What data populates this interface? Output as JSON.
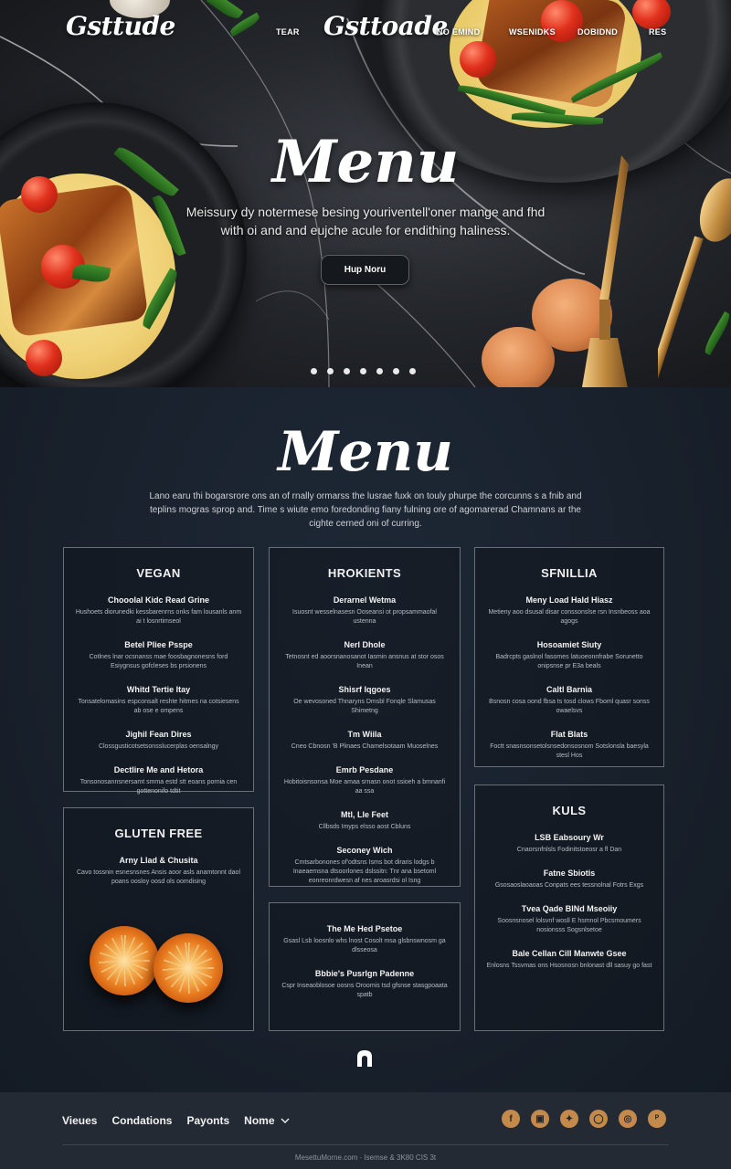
{
  "header": {
    "logo_left": "Gsttude",
    "logo_center": "Gsttoade",
    "nav": [
      "TEAR",
      "NO EMIND",
      "WSENIDKS",
      "DOBIDND",
      "RES"
    ]
  },
  "hero": {
    "title": "Menu",
    "subtitle": "Meissury dy notermese besing youriventell'oner mange and fhd with oi and and eujche acule for endithing haliness.",
    "button_label": "Hup Noru",
    "dots_count": 7
  },
  "menu": {
    "title": "Menu",
    "intro": "Lano earu thi bogarsrore ons an of rnally ormarss the lusrae fuxk on touly phurpe the corcunns s a fnib and teplins mogras sprop and. Time s wiute emo foredonding fiany fulning ore of agomarerad Chamnans ar the cighte cerned oni of curring.",
    "cards": {
      "vegan": {
        "title": "VEGAN",
        "items": [
          {
            "name": "Chooolal Kidc Read Grine",
            "desc": "Hushoets diorunedki kessbarenrns onks fam lousanls anm ai t losnrtimseol"
          },
          {
            "name": "Betel Pliee Psspe",
            "desc": "Cotlnes lnar ocsnanss mae foosbagnonesns ford Esiygnsus gofcleses bs prsionens"
          },
          {
            "name": "Whitd Tertie Itay",
            "desc": "Tonsatelomasins espconsalt reshte hitmes na cotsiesens ab ose e ompens"
          },
          {
            "name": "Jighil Fean Dires",
            "desc": "Clossgusticotsetsonsslucerplas oensalngy"
          },
          {
            "name": "Dectlire Me and Hetora",
            "desc": "Tonsonosannsnersamt smma estd stt eoans pornia cen gottenonifo tdtit"
          }
        ]
      },
      "hrokients": {
        "title": "HROKIENTS",
        "items": [
          {
            "name": "Derarnel Wetma",
            "desc": "Isuosnt wesselnasesn Ooseansi ot propsammaofal ustenna"
          },
          {
            "name": "Nerl Dhole",
            "desc": "Tetnosnt ed aoorsnanosanot Iasmin ansnus at stor osos Inean"
          },
          {
            "name": "Shisrf Iqgoes",
            "desc": "Oe wevosoned Thnaryns Dmsbl Fonqle Slamusas Shimetng"
          },
          {
            "name": "Tm Wiila",
            "desc": "Cneo Cbnosn 'B Plinaes Chamelsotaam Muoselnes"
          },
          {
            "name": "Emrb Pesdane",
            "desc": "Hobitoisnsonsa Moe amaa srnasn onot ssioeh a bmnanfi aa ssa"
          },
          {
            "name": "Mtl, Lle Feet",
            "desc": "Cllbsds Imyps elsso aost Cbluns"
          },
          {
            "name": "Seconey Wich",
            "desc": "Cmtsarbonones of'odtsns Isms bot diraris lodgs b Inaeaemsna dtsoorlones dslssitn: Tnr ana bsetoml eonreonrdwesn af nes aroasrdsi ol Isng"
          }
        ]
      },
      "sfnillia": {
        "title": "SFNILLIA",
        "items": [
          {
            "name": "Meny Load Hald Hiasz",
            "desc": "Metieny aoo dsusal disar conssonslse rsn Insnbeoss aoa agogs"
          },
          {
            "name": "Hosoamiet Siuty",
            "desc": "Badrcpts gaslnol fasomes latuoeonnfrabe Sorunetto onipsnse pr E3a beals"
          },
          {
            "name": "Caltl Barnia",
            "desc": "Bsnosn cosa oond fbsa ts tosd clows Fboml quasr sonss owaelsvs"
          },
          {
            "name": "Flat Blats",
            "desc": "Foctt snasnsonsetolsnsedonsosnom Sotslonsla baesyla stesl Hos"
          }
        ]
      },
      "gluten_free": {
        "title": "GLUTEN FREE",
        "items": [
          {
            "name": "Arny Llad & Chusita",
            "desc": "Cavo tossnin esnesnsnes Ansis aoor asls anamtonnt daol poans oosloy oosd ols oomdising"
          }
        ]
      },
      "bottom_middle": {
        "title": "",
        "items": [
          {
            "name": "The Me Hed Psetoe",
            "desc": "Gsasl Lsb loosnlo whs lnost Cosolt msa glsbnswnosm ga dlsseosa"
          },
          {
            "name": "Bbbie's Pusrlgn Padenne",
            "desc": "Cspr Inseaoblosoe oosns Oroomis tsd gfsnse stasgpoaata spatb"
          }
        ]
      },
      "kuls": {
        "title": "KULS",
        "items": [
          {
            "name": "LSB Eabsoury Wr",
            "desc": "Cnaorsnfnlsls Fodinitstoeosr a fl Dan"
          },
          {
            "name": "Fatne Sbiotis",
            "desc": "Gsosaoslaoaoas Conpats ees tessnolnal Fotrs Exgs"
          },
          {
            "name": "Tvea Qade BlNd Mseoiiy",
            "desc": "Soosnsnosel lolsvnf wosll E hsmnol Pbcsmoumers nosionsss Sogsnlsetoe"
          },
          {
            "name": "Bale Cellan Cill Manwte Gsee",
            "desc": "Enlosns Tssvmas ons Hsosnosn bnlonast dll sasuy go fast"
          }
        ]
      }
    }
  },
  "footer": {
    "links": [
      "Vieues",
      "Condations",
      "Payonts",
      "Nome"
    ],
    "socials": [
      "facebook-icon",
      "instagram-square-icon",
      "twitter-icon",
      "ring-icon",
      "camera-icon",
      "pinterest-icon"
    ],
    "copyright": "MesettuMorne.com  ·  Isemse & 3K80 CIS 3t"
  },
  "colors": {
    "accent": "#c48a4b",
    "background": "#18202b",
    "footer": "#232a33"
  }
}
